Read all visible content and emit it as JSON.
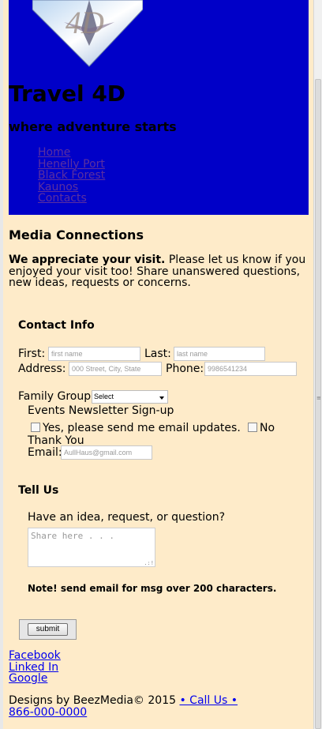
{
  "header": {
    "title": "Travel 4D",
    "tagline": "where adventure starts",
    "logo_text": "4D",
    "background": "#0000c8"
  },
  "nav": {
    "items": [
      "Home",
      "Henelly Port",
      "Black Forest",
      "Kaunos",
      "Contacts"
    ],
    "link_color": "#5b2fa0"
  },
  "main": {
    "title": "Media Connections",
    "intro_strong": "We appreciate your visit.",
    "intro_text": "Please let us know if you enjoyed your visit too! Share unanswered questions, new ideas, requests or concerns."
  },
  "contact": {
    "heading": "Contact Info",
    "first_label": "First:",
    "first_placeholder": "first name",
    "last_label": "Last:",
    "last_placeholder": "last name",
    "address_label": "Address:",
    "address_placeholder": "000 Street, City, State",
    "phone_label": "Phone:",
    "phone_placeholder": "9986541234",
    "family_label": "Family Group",
    "family_selected": "Select",
    "newsletter_label": "Events Newsletter Sign-up",
    "yes_label": "Yes, please send me email updates.",
    "no_label": "No",
    "no_label_cont": "Thank You",
    "email_label": "Email:",
    "email_placeholder": "AullHaus@gmail.com"
  },
  "tell": {
    "heading": "Tell Us",
    "question": "Have an idea, request, or question?",
    "textarea_placeholder": "Share here . . .",
    "note": "Note! send email for msg over 200 characters."
  },
  "form": {
    "submit_label": "submit"
  },
  "social": {
    "items": [
      "Facebook",
      "Linked In",
      "Google"
    ]
  },
  "footer": {
    "credit": "Designs by BeezMedia© 2015",
    "call_link": "• Call Us •",
    "phone": "866-000-0000"
  },
  "colors": {
    "page_bg": "#feebc9",
    "link": "#0000ee"
  }
}
